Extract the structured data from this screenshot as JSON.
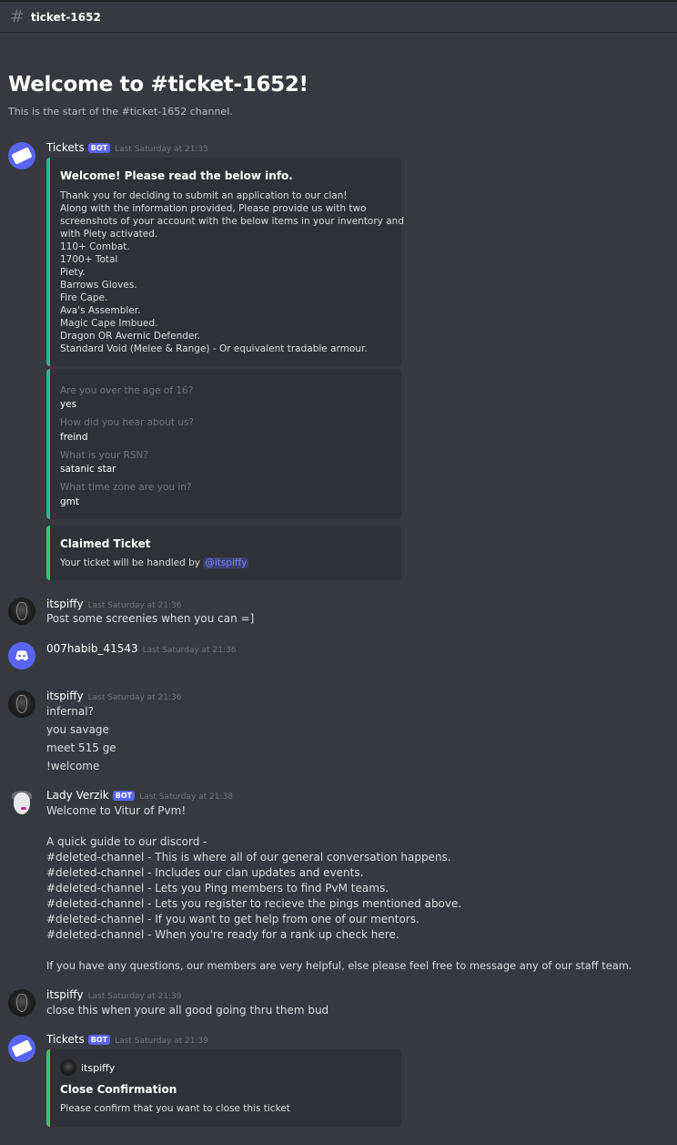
{
  "channel": {
    "name": "ticket-1652",
    "hash_icon": "hash-icon",
    "welcome_title": "Welcome to #ticket-1652!",
    "welcome_subtitle": "This is the start of the #ticket-1652 channel."
  },
  "messages": [
    {
      "author": "Tickets",
      "bot": true,
      "bot_label": "BOT",
      "timestamp": "Last Saturday at 21:35",
      "embeds": [
        {
          "color": "#1abc9c",
          "title": "Welcome! Please read the below info.",
          "lines": [
            "Thank you for deciding to submit an application to our clan!",
            "Along with the information provided, Please provide us with two",
            "screenshots of your account with the below items in your inventory and",
            "with Piety activated.",
            "110+ Combat.",
            "1700+ Total",
            "Piety.",
            "Barrows Gloves.",
            "Fire Cape.",
            "Ava's Assembler.",
            "Magic Cape Imbued.",
            "Dragon OR Avernic Defender.",
            "Standard Void (Melee & Range) - Or equivalent tradable armour."
          ]
        },
        {
          "color": "#1abc9c",
          "fields": [
            {
              "name": "Are you over the age of 16?",
              "value": "yes"
            },
            {
              "name": "How did you hear about us?",
              "value": "freind"
            },
            {
              "name": "What is your RSN?",
              "value": "satanic star"
            },
            {
              "name": "What time zone are you in?",
              "value": "gmt"
            }
          ]
        },
        {
          "color": "#2ecc71",
          "title": "Claimed Ticket",
          "description_prefix": "Your ticket will be handled by ",
          "mention": "@itspiffy"
        }
      ]
    },
    {
      "author": "itspiffy",
      "timestamp": "Last Saturday at 21:36",
      "lines": [
        "Post some screenies when you can =]"
      ]
    },
    {
      "author": "007habib_41543",
      "timestamp": "Last Saturday at 21:36",
      "lines": []
    },
    {
      "author": "itspiffy",
      "timestamp": "Last Saturday at 21:36",
      "lines": [
        "infernal?",
        "you savage",
        "meet 515 ge",
        "!welcome"
      ]
    },
    {
      "author": "Lady Verzik",
      "bot": true,
      "bot_label": "BOT",
      "timestamp": "Last Saturday at 21:38",
      "lines": [
        "Welcome to Vitur of Pvm!",
        "",
        "A quick guide to our discord -",
        "#deleted-channel - This is where all of our general conversation happens.",
        "#deleted-channel - Includes our clan updates and events.",
        "#deleted-channel - Lets you Ping members to find PvM teams.",
        "#deleted-channel - Lets you register to recieve the pings mentioned above.",
        "#deleted-channel - If you want to get help from one of our mentors.",
        "#deleted-channel - When you're ready for a rank up check here.",
        "",
        "If you have any questions, our members are very helpful, else please feel free to message any of our staff team."
      ]
    },
    {
      "author": "itspiffy",
      "timestamp": "Last Saturday at 21:39",
      "lines": [
        "close this when youre all good going thru them bud"
      ]
    },
    {
      "author": "Tickets",
      "bot": true,
      "bot_label": "BOT",
      "timestamp": "Last Saturday at 21:39",
      "embeds": [
        {
          "color": "#2ecc71",
          "author": "itspiffy",
          "title": "Close Confirmation",
          "description": "Please confirm that you want to close this ticket"
        }
      ]
    }
  ]
}
